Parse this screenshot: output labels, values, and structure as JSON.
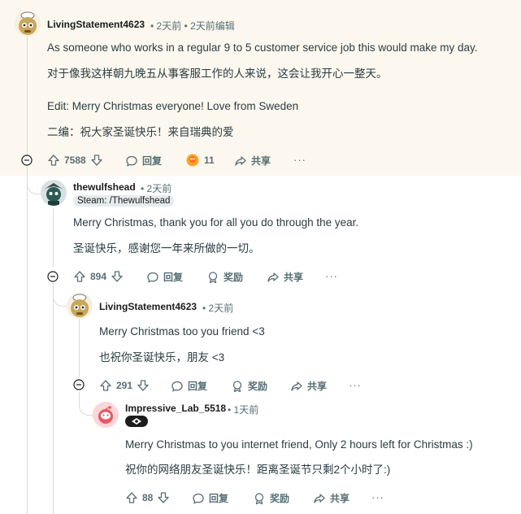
{
  "comments": [
    {
      "username": "LivingStatement4623",
      "meta": "• 2天前 • 2天前编辑",
      "lines": [
        "As someone who works in a regular 9 to 5 customer service job this would make my day.",
        "对于像我这样朝九晚五从事客服工作的人来说，这会让我开心一整天。",
        "Edit: Merry Christmas everyone! Love from Sweden",
        "二编：祝大家圣诞快乐！来自瑞典的爱"
      ],
      "votes": "7588",
      "reply_label": "回复",
      "award_count": "11",
      "share_label": "共享",
      "more_label": "···"
    },
    {
      "username": "thewulfshead",
      "meta": "• 2天前",
      "flair": "Steam: /Thewulfshead",
      "lines": [
        "Merry Christmas, thank you for all you do through the year.",
        "圣诞快乐，感谢您一年来所做的一切。"
      ],
      "votes": "894",
      "reply_label": "回复",
      "award_label": "奖励",
      "share_label": "共享",
      "more_label": "···"
    },
    {
      "username": "LivingStatement4623",
      "meta": "• 2天前",
      "lines": [
        "Merry Christmas too you friend <3",
        "也祝你圣诞快乐，朋友 <3"
      ],
      "votes": "291",
      "reply_label": "回复",
      "award_label": "奖励",
      "share_label": "共享",
      "more_label": "···"
    },
    {
      "username": "Impressive_Lab_5518",
      "meta": "• 1天前",
      "lines": [
        "Merry Christmas to you internet friend, Only 2 hours left for Christmas :)",
        "祝你的网络朋友圣诞快乐！距离圣诞节只剩2个小时了:)"
      ],
      "votes": "88",
      "reply_label": "回复",
      "award_label": "奖励",
      "share_label": "共享",
      "more_label": "···"
    }
  ],
  "colors": {
    "highlight_bg": "#fcf8ef",
    "meta_text": "#576f76",
    "body_text": "#2a3c42",
    "thread_line": "#d9dadb"
  }
}
